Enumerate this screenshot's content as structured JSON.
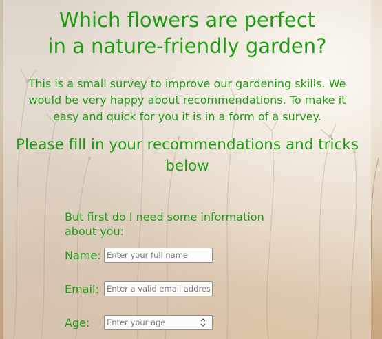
{
  "page": {
    "title_line1": "Which flowers are perfect",
    "title_line2": "in a nature-friendly garden?",
    "intro": "This is a small survey to improve our gardening skills. We would be very happy about recommendations. To make it easy and quick for you it is in a form of a survey.",
    "subheading": "Please fill in your recommendations and tricks below"
  },
  "form": {
    "intro": "But first do I need some information about you:",
    "name_label": "Name:",
    "name_placeholder": "Enter your full name",
    "email_label": "Email:",
    "email_placeholder": "Enter a valid email address",
    "age_label": "Age:",
    "age_placeholder": "Enter your age"
  },
  "colors": {
    "text_green": "#1f9c14",
    "panel_overlay": "rgba(255,255,255,0.35)"
  },
  "icons": {
    "age_spinner": "number-spinner-icon"
  }
}
